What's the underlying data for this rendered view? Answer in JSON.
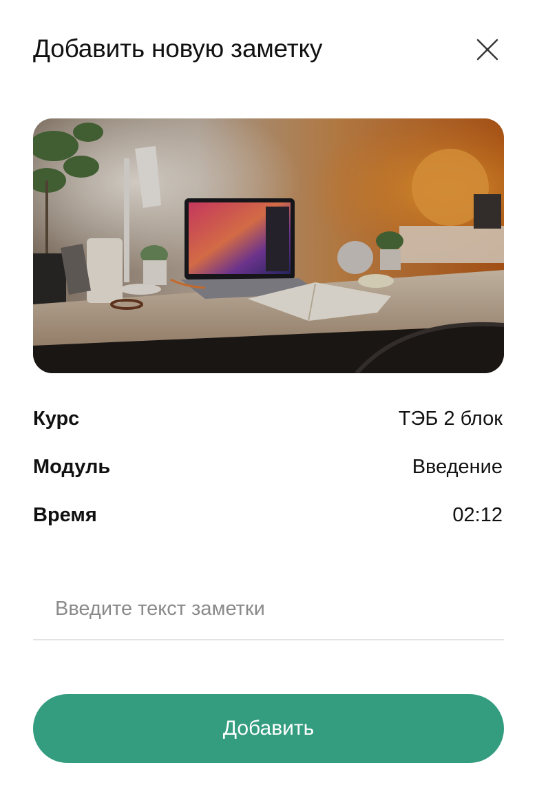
{
  "dialog": {
    "title": "Добавить новую заметку",
    "close_icon": "close-icon"
  },
  "image": {
    "description_icon": "desk-photo"
  },
  "info": {
    "rows": [
      {
        "label": "Курс",
        "value": "ТЭБ 2 блок"
      },
      {
        "label": "Модуль",
        "value": "Введение"
      },
      {
        "label": "Время",
        "value": "02:12"
      }
    ]
  },
  "note": {
    "value": "",
    "placeholder": "Введите текст заметки"
  },
  "submit": {
    "label": "Добавить"
  },
  "colors": {
    "accent": "#349c7f",
    "text": "#111111",
    "placeholder": "#8a8a8a",
    "divider": "#e3e3e3"
  }
}
